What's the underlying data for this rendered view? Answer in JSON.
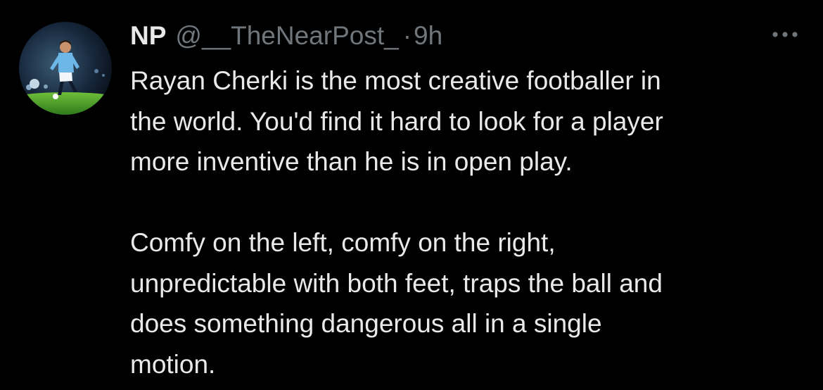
{
  "tweet": {
    "avatar_icon": "profile-avatar-footballer",
    "display_name": "NP",
    "handle": "@__TheNearPost_",
    "separator": "·",
    "time": "9h",
    "more_icon": "more-options-icon",
    "paragraphs": [
      [
        "Rayan Cherki is the most creative footballer in",
        "the world. You'd find it hard to look for a player",
        "more inventive than he is in open play."
      ],
      [
        "Comfy on the left, comfy on the right,",
        "unpredictable with both feet, traps the ball and",
        "does something dangerous all in a single",
        "motion."
      ]
    ]
  },
  "colors": {
    "background": "#000000",
    "primary_text": "#e7e9ea",
    "secondary_text": "#71767b"
  }
}
